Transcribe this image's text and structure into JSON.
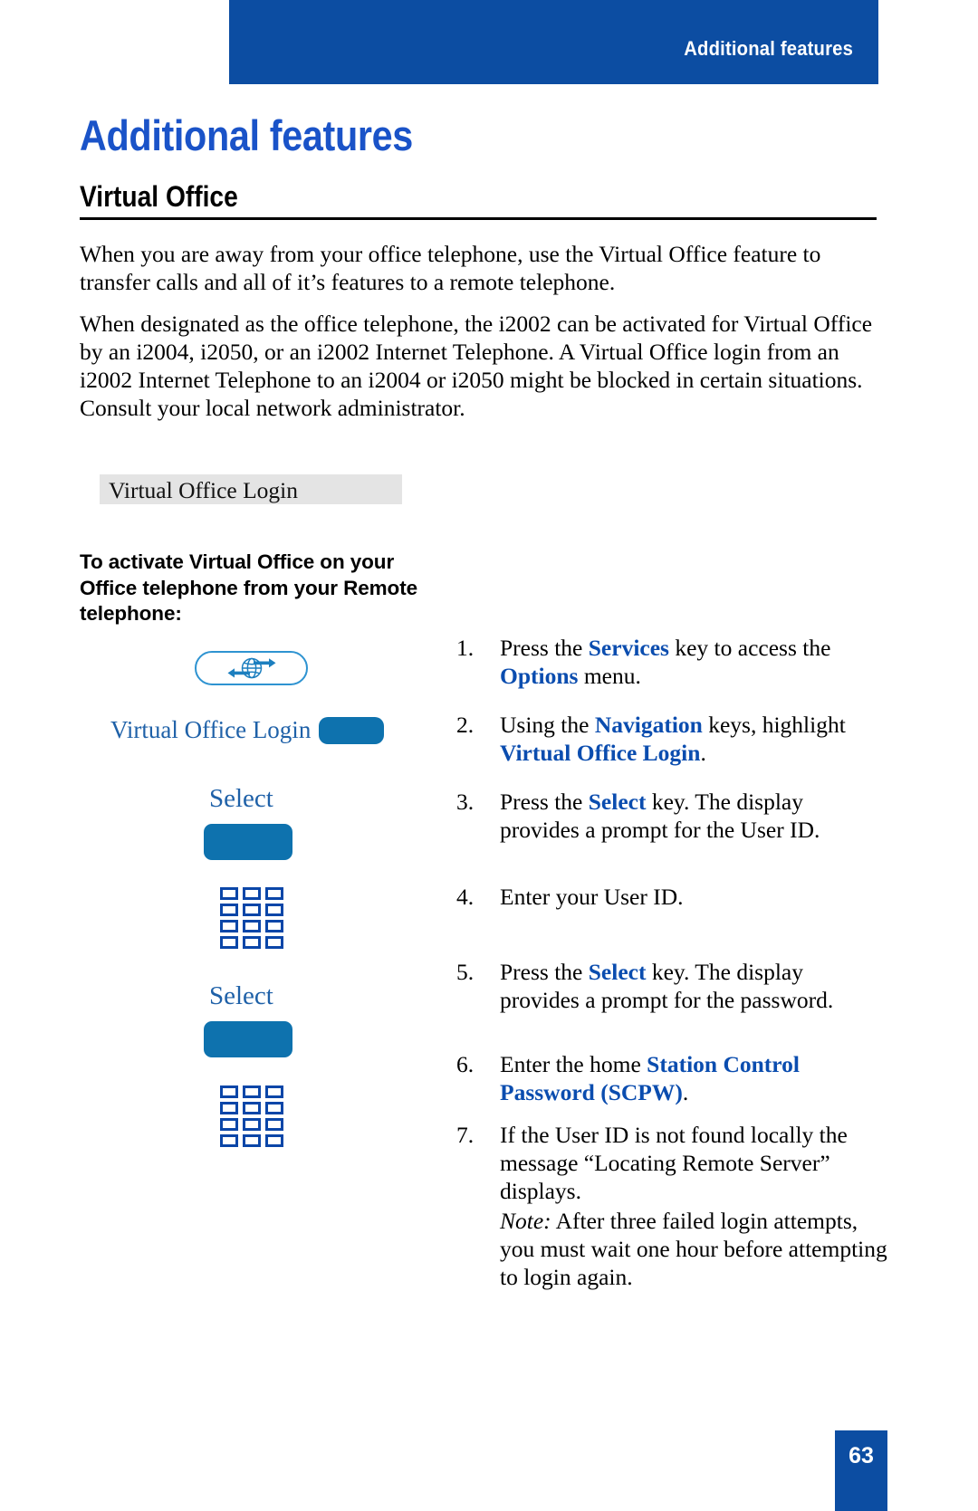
{
  "header": {
    "running_head": "Additional features",
    "bar_color": "#0C4DA2"
  },
  "title": {
    "h1": "Additional features",
    "h1_color": "#1A53C8",
    "h2": "Virtual Office"
  },
  "body": {
    "paragraph_1": "When you are away from your office telephone, use the Virtual Office feature to transfer calls and all of it’s features to a remote telephone.",
    "paragraph_2": "When designated as the office telephone, the i2002 can be activated for Virtual Office by an i2004, i2050, or an i2002 Internet Telephone. A Virtual Office login from an i2002 Internet Telephone to an i2004 or i2050 might be blocked in certain situations. Consult your local network administrator."
  },
  "callout": {
    "label": "Virtual Office Login",
    "background": "#E4E4E4"
  },
  "procedure": {
    "heading": "To activate Virtual Office on your Office telephone from your Remote telephone:"
  },
  "keys": {
    "services_icon": "globe-services-icon",
    "display_line_label": "Virtual Office Login",
    "select_label_1": "Select",
    "select_label_2": "Select",
    "keypad_icon": "dialpad-icon",
    "key_color": "#0E72AE",
    "outline_color": "#2E93D1",
    "label_color": "#1F61A8"
  },
  "steps": [
    {
      "num": "1.",
      "parts": [
        {
          "t": "Press the ",
          "k": false
        },
        {
          "t": "Services",
          "k": true
        },
        {
          "t": " key to access the ",
          "k": false
        },
        {
          "t": "Options",
          "k": true
        },
        {
          "t": " menu.",
          "k": false
        }
      ]
    },
    {
      "num": "2.",
      "parts": [
        {
          "t": "Using the ",
          "k": false
        },
        {
          "t": "Navigation",
          "k": true
        },
        {
          "t": " keys, highlight ",
          "k": false
        },
        {
          "t": "Virtual Office Login",
          "k": true
        },
        {
          "t": ".",
          "k": false
        }
      ]
    },
    {
      "num": "3.",
      "parts": [
        {
          "t": "Press the ",
          "k": false
        },
        {
          "t": "Select",
          "k": true
        },
        {
          "t": " key. The display provides a prompt for the User ID.",
          "k": false
        }
      ]
    },
    {
      "num": "4.",
      "parts": [
        {
          "t": "Enter your User ID.",
          "k": false
        }
      ]
    },
    {
      "num": "5.",
      "parts": [
        {
          "t": "Press the ",
          "k": false
        },
        {
          "t": "Select",
          "k": true
        },
        {
          "t": " key. The display provides a prompt for the password.",
          "k": false
        }
      ]
    },
    {
      "num": "6.",
      "parts": [
        {
          "t": "Enter the home ",
          "k": false
        },
        {
          "t": "Station Control Password (SCPW)",
          "k": true
        },
        {
          "t": ".",
          "k": false
        }
      ]
    },
    {
      "num": "7.",
      "parts": [
        {
          "t": "If the User ID is not found locally the message “Locating Remote Server” displays.",
          "k": false
        }
      ]
    }
  ],
  "note": {
    "label": "Note:",
    "text": " After three failed login attempts, you must wait one hour before attempting to login again."
  },
  "footer": {
    "page_number": "63",
    "box_color": "#0C4DA2"
  },
  "keyword_color": "#0B4DAF"
}
